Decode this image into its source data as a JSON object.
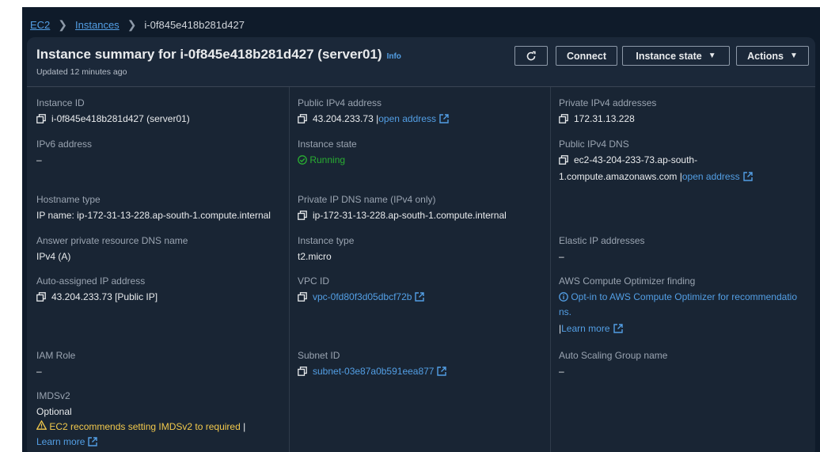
{
  "breadcrumb": {
    "root": "EC2",
    "instances": "Instances",
    "current": "i-0f845e418b281d427"
  },
  "header": {
    "title": "Instance summary for i-0f845e418b281d427 (server01)",
    "info": "Info",
    "updated": "Updated 12 minutes ago",
    "connect": "Connect",
    "instance_state": "Instance state",
    "actions": "Actions"
  },
  "fields": {
    "instance_id_label": "Instance ID",
    "instance_id": "i-0f845e418b281d427 (server01)",
    "public_ipv4_label": "Public IPv4 address",
    "public_ipv4": "43.204.233.73",
    "public_ipv4_sep": "|",
    "open_address": "open address",
    "private_ipv4_label": "Private IPv4 addresses",
    "private_ipv4": "172.31.13.228",
    "ipv6_label": "IPv6 address",
    "ipv6": "–",
    "instance_state_label": "Instance state",
    "instance_state": "Running",
    "public_dns_label": "Public IPv4 DNS",
    "public_dns_line1": "ec2-43-204-233-73.ap-south-",
    "public_dns_line2": "1.compute.amazonaws.com",
    "public_dns_sep": "|",
    "public_dns_open": "open address",
    "hostname_type_label": "Hostname type",
    "hostname_type": "IP name: ip-172-31-13-228.ap-south-1.compute.internal",
    "private_dns_label": "Private IP DNS name (IPv4 only)",
    "private_dns": "ip-172-31-13-228.ap-south-1.compute.internal",
    "answer_dns_label": "Answer private resource DNS name",
    "answer_dns": "IPv4 (A)",
    "instance_type_label": "Instance type",
    "instance_type": "t2.micro",
    "elastic_ip_label": "Elastic IP addresses",
    "elastic_ip": "–",
    "auto_ip_label": "Auto-assigned IP address",
    "auto_ip": "43.204.233.73 [Public IP]",
    "vpc_label": "VPC ID",
    "vpc": "vpc-0fd80f3d05dbcf72b",
    "optimizer_label": "AWS Compute Optimizer finding",
    "optimizer_line1": "Opt-in to AWS Compute Optimizer for recommendatio",
    "optimizer_line2": "ns.",
    "optimizer_learn_sep": "|",
    "optimizer_learn": "Learn more",
    "iam_label": "IAM Role",
    "iam": "–",
    "subnet_label": "Subnet ID",
    "subnet": "subnet-03e87a0b591eea877",
    "asg_label": "Auto Scaling Group name",
    "asg": "–",
    "imds_label": "IMDSv2",
    "imds": "Optional",
    "imds_warning": "EC2 recommends setting IMDSv2 to required",
    "imds_warning_sep": "|",
    "imds_learn": "Learn more"
  },
  "colors": {
    "link": "#539fe5",
    "running": "#29ad32",
    "warning": "#f2c94c"
  },
  "icons": [
    "copy-icon",
    "external-link-icon",
    "refresh-icon",
    "caret-down-icon",
    "check-circle-icon",
    "info-circle-icon",
    "warning-icon"
  ]
}
